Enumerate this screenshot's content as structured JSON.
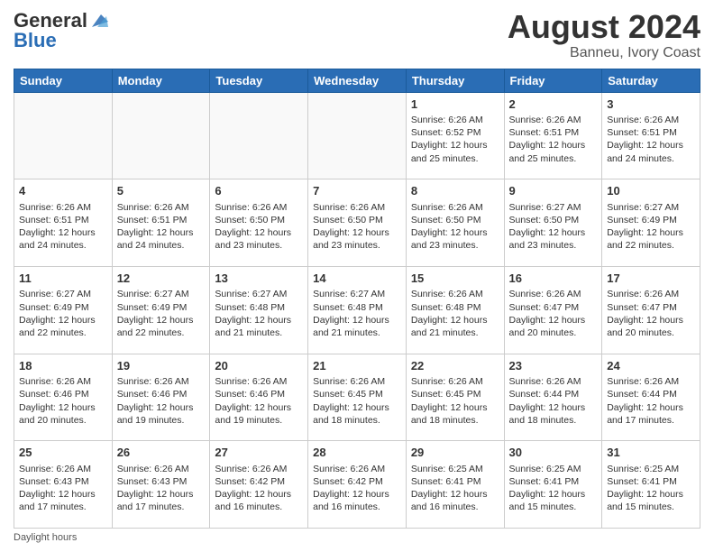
{
  "header": {
    "logo_general": "General",
    "logo_blue": "Blue",
    "month_title": "August 2024",
    "location": "Banneu, Ivory Coast"
  },
  "footer": {
    "note": "Daylight hours"
  },
  "days_of_week": [
    "Sunday",
    "Monday",
    "Tuesday",
    "Wednesday",
    "Thursday",
    "Friday",
    "Saturday"
  ],
  "weeks": [
    [
      {
        "day": "",
        "info": ""
      },
      {
        "day": "",
        "info": ""
      },
      {
        "day": "",
        "info": ""
      },
      {
        "day": "",
        "info": ""
      },
      {
        "day": "1",
        "info": "Sunrise: 6:26 AM\nSunset: 6:52 PM\nDaylight: 12 hours\nand 25 minutes."
      },
      {
        "day": "2",
        "info": "Sunrise: 6:26 AM\nSunset: 6:51 PM\nDaylight: 12 hours\nand 25 minutes."
      },
      {
        "day": "3",
        "info": "Sunrise: 6:26 AM\nSunset: 6:51 PM\nDaylight: 12 hours\nand 24 minutes."
      }
    ],
    [
      {
        "day": "4",
        "info": "Sunrise: 6:26 AM\nSunset: 6:51 PM\nDaylight: 12 hours\nand 24 minutes."
      },
      {
        "day": "5",
        "info": "Sunrise: 6:26 AM\nSunset: 6:51 PM\nDaylight: 12 hours\nand 24 minutes."
      },
      {
        "day": "6",
        "info": "Sunrise: 6:26 AM\nSunset: 6:50 PM\nDaylight: 12 hours\nand 23 minutes."
      },
      {
        "day": "7",
        "info": "Sunrise: 6:26 AM\nSunset: 6:50 PM\nDaylight: 12 hours\nand 23 minutes."
      },
      {
        "day": "8",
        "info": "Sunrise: 6:26 AM\nSunset: 6:50 PM\nDaylight: 12 hours\nand 23 minutes."
      },
      {
        "day": "9",
        "info": "Sunrise: 6:27 AM\nSunset: 6:50 PM\nDaylight: 12 hours\nand 23 minutes."
      },
      {
        "day": "10",
        "info": "Sunrise: 6:27 AM\nSunset: 6:49 PM\nDaylight: 12 hours\nand 22 minutes."
      }
    ],
    [
      {
        "day": "11",
        "info": "Sunrise: 6:27 AM\nSunset: 6:49 PM\nDaylight: 12 hours\nand 22 minutes."
      },
      {
        "day": "12",
        "info": "Sunrise: 6:27 AM\nSunset: 6:49 PM\nDaylight: 12 hours\nand 22 minutes."
      },
      {
        "day": "13",
        "info": "Sunrise: 6:27 AM\nSunset: 6:48 PM\nDaylight: 12 hours\nand 21 minutes."
      },
      {
        "day": "14",
        "info": "Sunrise: 6:27 AM\nSunset: 6:48 PM\nDaylight: 12 hours\nand 21 minutes."
      },
      {
        "day": "15",
        "info": "Sunrise: 6:26 AM\nSunset: 6:48 PM\nDaylight: 12 hours\nand 21 minutes."
      },
      {
        "day": "16",
        "info": "Sunrise: 6:26 AM\nSunset: 6:47 PM\nDaylight: 12 hours\nand 20 minutes."
      },
      {
        "day": "17",
        "info": "Sunrise: 6:26 AM\nSunset: 6:47 PM\nDaylight: 12 hours\nand 20 minutes."
      }
    ],
    [
      {
        "day": "18",
        "info": "Sunrise: 6:26 AM\nSunset: 6:46 PM\nDaylight: 12 hours\nand 20 minutes."
      },
      {
        "day": "19",
        "info": "Sunrise: 6:26 AM\nSunset: 6:46 PM\nDaylight: 12 hours\nand 19 minutes."
      },
      {
        "day": "20",
        "info": "Sunrise: 6:26 AM\nSunset: 6:46 PM\nDaylight: 12 hours\nand 19 minutes."
      },
      {
        "day": "21",
        "info": "Sunrise: 6:26 AM\nSunset: 6:45 PM\nDaylight: 12 hours\nand 18 minutes."
      },
      {
        "day": "22",
        "info": "Sunrise: 6:26 AM\nSunset: 6:45 PM\nDaylight: 12 hours\nand 18 minutes."
      },
      {
        "day": "23",
        "info": "Sunrise: 6:26 AM\nSunset: 6:44 PM\nDaylight: 12 hours\nand 18 minutes."
      },
      {
        "day": "24",
        "info": "Sunrise: 6:26 AM\nSunset: 6:44 PM\nDaylight: 12 hours\nand 17 minutes."
      }
    ],
    [
      {
        "day": "25",
        "info": "Sunrise: 6:26 AM\nSunset: 6:43 PM\nDaylight: 12 hours\nand 17 minutes."
      },
      {
        "day": "26",
        "info": "Sunrise: 6:26 AM\nSunset: 6:43 PM\nDaylight: 12 hours\nand 17 minutes."
      },
      {
        "day": "27",
        "info": "Sunrise: 6:26 AM\nSunset: 6:42 PM\nDaylight: 12 hours\nand 16 minutes."
      },
      {
        "day": "28",
        "info": "Sunrise: 6:26 AM\nSunset: 6:42 PM\nDaylight: 12 hours\nand 16 minutes."
      },
      {
        "day": "29",
        "info": "Sunrise: 6:25 AM\nSunset: 6:41 PM\nDaylight: 12 hours\nand 16 minutes."
      },
      {
        "day": "30",
        "info": "Sunrise: 6:25 AM\nSunset: 6:41 PM\nDaylight: 12 hours\nand 15 minutes."
      },
      {
        "day": "31",
        "info": "Sunrise: 6:25 AM\nSunset: 6:41 PM\nDaylight: 12 hours\nand 15 minutes."
      }
    ]
  ]
}
